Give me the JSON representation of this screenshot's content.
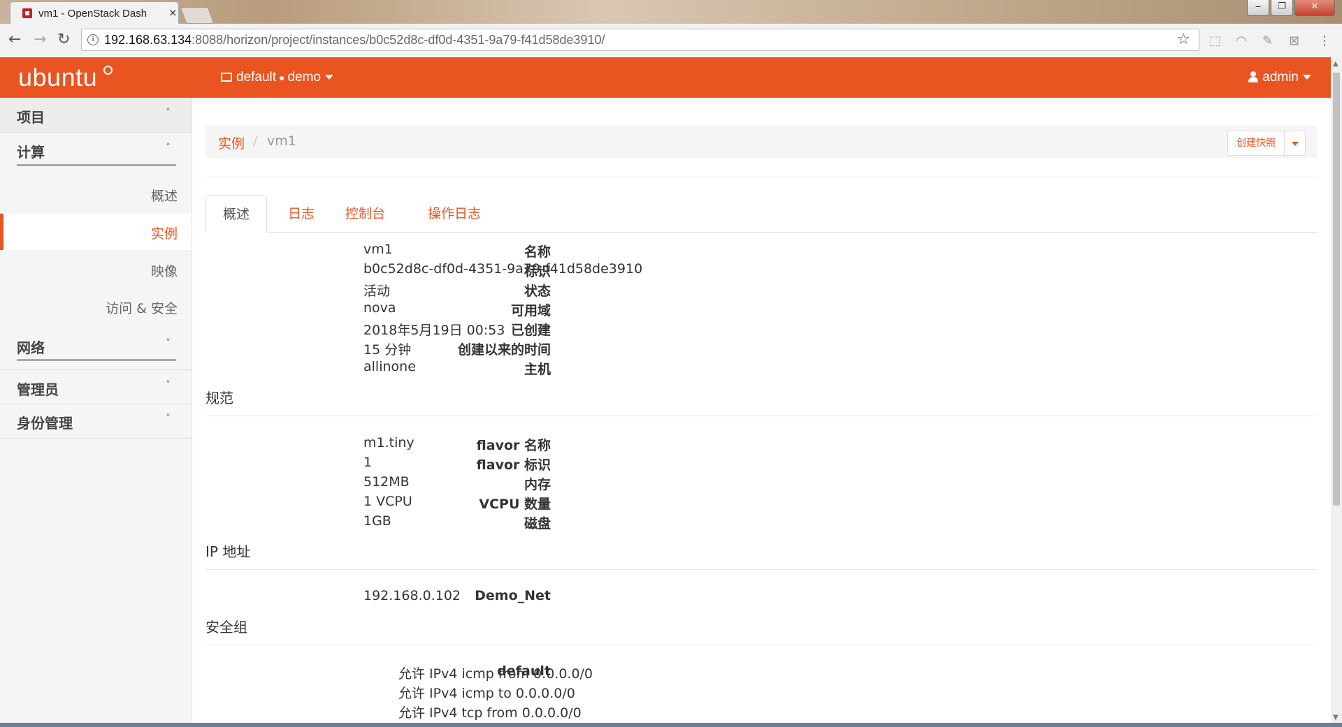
{
  "browser": {
    "tab_title": "vm1 - OpenStack Dash",
    "tab_close": "×",
    "url_host": "192.168.63.134",
    "url_rest": ":8088/horizon/project/instances/b0c52d8c-df0d-4351-9a79-f41d58de3910/",
    "window_controls": {
      "minimize": "‒",
      "maximize": "❐",
      "close": "✕"
    }
  },
  "topnav": {
    "brand": "ubuntu",
    "domain": "default",
    "project": "demo",
    "user": "admin"
  },
  "sidebar": {
    "project": "项目",
    "compute": "计算",
    "overview": "概述",
    "instances": "实例",
    "images": "映像",
    "access_security": "访问 & 安全",
    "network": "网络",
    "admin": "管理员",
    "identity": "身份管理"
  },
  "breadcrumb": {
    "parent": "实例",
    "separator": "/",
    "current": "vm1"
  },
  "actions": {
    "create_snapshot": "创建快照"
  },
  "tabs": [
    "概述",
    "日志",
    "控制台",
    "操作日志"
  ],
  "overview": [
    {
      "key": "名称",
      "value": "vm1"
    },
    {
      "key": "标识",
      "value": "b0c52d8c-df0d-4351-9a79-f41d58de3910"
    },
    {
      "key": "状态",
      "value": "活动"
    },
    {
      "key": "可用域",
      "value": "nova"
    },
    {
      "key": "已创建",
      "value": "2018年5月19日 00:53"
    },
    {
      "key": "创建以来的时间",
      "value": "15 分钟"
    },
    {
      "key": "主机",
      "value": "allinone"
    }
  ],
  "spec_title": "规范",
  "spec": [
    {
      "key": "flavor 名称",
      "value": "m1.tiny"
    },
    {
      "key": "flavor 标识",
      "value": "1"
    },
    {
      "key": "内存",
      "value": "512MB"
    },
    {
      "key": "VCPU 数量",
      "value": "1 VCPU"
    },
    {
      "key": "磁盘",
      "value": "1GB"
    }
  ],
  "ip_title": "IP 地址",
  "ip": [
    {
      "key": "Demo_Net",
      "value": "192.168.0.102"
    }
  ],
  "sg_title": "安全组",
  "security_group": {
    "name": "default",
    "rules": [
      "允许 IPv4 icmp from 0.0.0.0/0",
      "允许 IPv4 icmp to 0.0.0.0/0",
      "允许 IPv4 tcp from 0.0.0.0/0"
    ]
  },
  "colors": {
    "accent": "#e95420",
    "sidebar_bg": "#f5f5f5"
  }
}
